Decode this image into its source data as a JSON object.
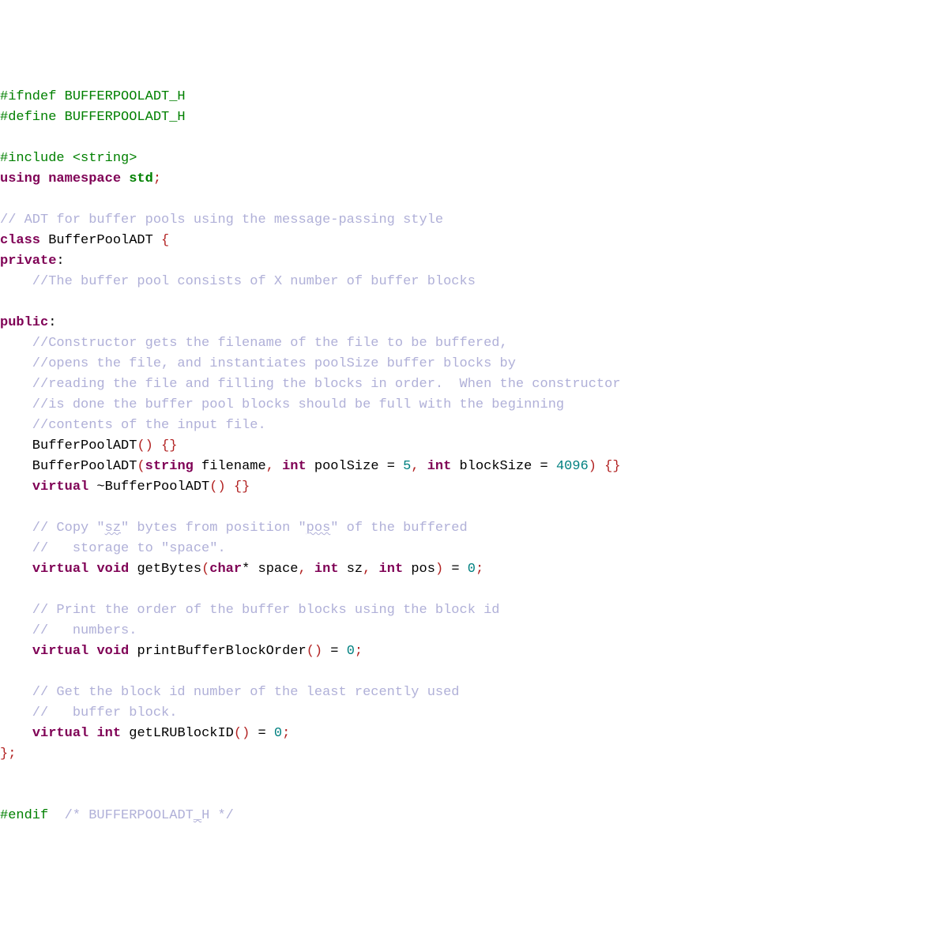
{
  "lines": {
    "l1": "#ifndef BUFFERPOOLADT_H",
    "l2": "#define BUFFERPOOLADT_H",
    "l3": "",
    "l4a": "#include ",
    "l4b": "<string>",
    "l5a": "using",
    "l5b": " namespace ",
    "l5c": "std",
    "l5d": ";",
    "l6": "",
    "l7": "// ADT for buffer pools using the message-passing style",
    "l8a": "class",
    "l8b": " BufferPoolADT ",
    "l8c": "{",
    "l9a": "private",
    "l9b": ":",
    "l10": "    //The buffer pool consists of X number of buffer blocks",
    "l11": "    ",
    "l12a": "public",
    "l12b": ":",
    "l13": "    //Constructor gets the filename of the file to be buffered,",
    "l14": "    //opens the file, and instantiates poolSize buffer blocks by",
    "l15": "    //reading the file and filling the blocks in order.  When the constructor",
    "l16": "    //is done the buffer pool blocks should be full with the beginning",
    "l17": "    //contents of the input file.",
    "l18a": "    BufferPoolADT",
    "l18b": "()",
    "l18c": " {}",
    "l19a": "    BufferPoolADT",
    "l19b": "(",
    "l19c": "string",
    "l19d": " filename",
    "l19e": ", ",
    "l19f": "int",
    "l19g": " poolSize = ",
    "l19h": "5",
    "l19i": ", ",
    "l19j": "int",
    "l19k": " blockSize = ",
    "l19l": "4096",
    "l19m": ")",
    "l19n": " {}",
    "l20a": "    ",
    "l20b": "virtual",
    "l20c": " ~BufferPoolADT",
    "l20d": "()",
    "l20e": " {}",
    "l21": "    ",
    "l22a": "    // Copy \"",
    "l22b": "sz",
    "l22c": "\" bytes from position \"",
    "l22d": "pos",
    "l22e": "\" of the buffered",
    "l23": "    //   storage to \"space\".",
    "l24a": "    ",
    "l24b": "virtual",
    "l24c": " ",
    "l24d": "void",
    "l24e": " getBytes",
    "l24f": "(",
    "l24g": "char",
    "l24h": "* space",
    "l24i": ", ",
    "l24j": "int",
    "l24k": " sz",
    "l24l": ", ",
    "l24m": "int",
    "l24n": " pos",
    "l24o": ")",
    "l24p": " = ",
    "l24q": "0",
    "l24r": ";",
    "l25": "",
    "l26": "    // Print the order of the buffer blocks using the block id",
    "l27": "    //   numbers.",
    "l28a": "    ",
    "l28b": "virtual",
    "l28c": " ",
    "l28d": "void",
    "l28e": " printBufferBlockOrder",
    "l28f": "()",
    "l28g": " = ",
    "l28h": "0",
    "l28i": ";",
    "l29": "",
    "l30": "    // Get the block id number of the least recently used ",
    "l31": "    //   buffer block.",
    "l32a": "    ",
    "l32b": "virtual",
    "l32c": " ",
    "l32d": "int",
    "l32e": " getLRUBlockID",
    "l32f": "()",
    "l32g": " = ",
    "l32h": "0",
    "l32i": ";",
    "l33a": "}",
    "l33b": ";",
    "l34": "",
    "l35": "",
    "l36a": "#endif",
    "l36b": "  /* BUFFERPOOLADT",
    "l36c": "_",
    "l36d": "H */"
  }
}
